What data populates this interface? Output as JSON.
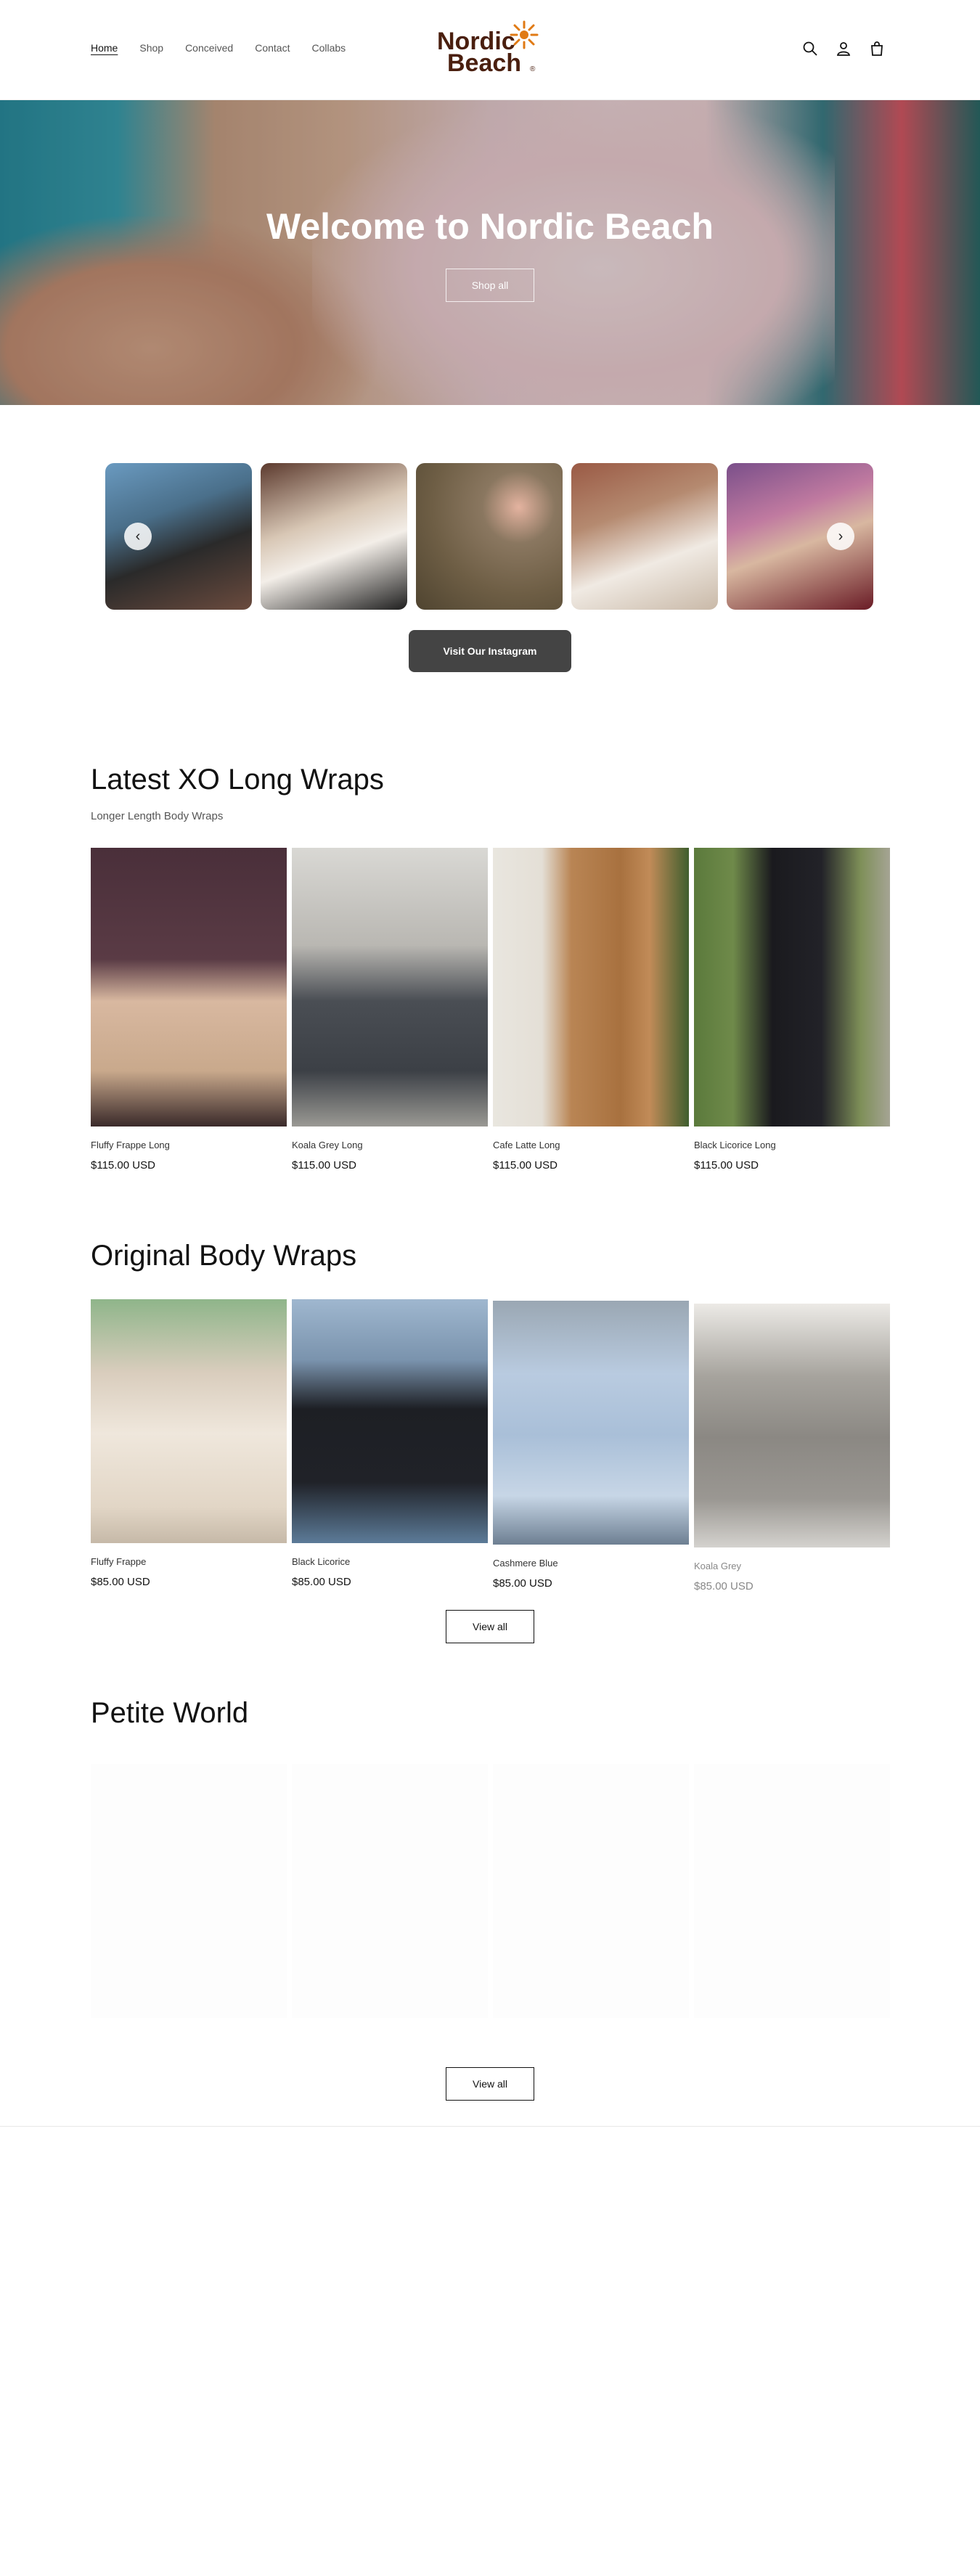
{
  "header": {
    "nav": [
      "Home",
      "Shop",
      "Conceived",
      "Contact",
      "Collabs"
    ],
    "logo_line1": "Nordic",
    "logo_line2": "Beach",
    "logo_mark": "®",
    "icons": [
      "search-icon",
      "account-icon",
      "cart-icon"
    ],
    "brand_color": "#4a1f0f",
    "sun_color": "#e07a14"
  },
  "hero": {
    "title": "Welcome to Nordic Beach",
    "button": "Shop all"
  },
  "instagram": {
    "button": "Visit Our Instagram",
    "arrow_prev": "‹",
    "arrow_next": "›"
  },
  "latest": {
    "title": "Latest XO Long Wraps",
    "subtitle": "Longer Length Body Wraps",
    "products": [
      {
        "name": "Fluffy Frappe Long",
        "price": "$115.00 USD"
      },
      {
        "name": "Koala Grey Long",
        "price": "$115.00 USD"
      },
      {
        "name": "Cafe Latte Long",
        "price": "$115.00 USD"
      },
      {
        "name": "Black Licorice Long",
        "price": "$115.00 USD"
      }
    ]
  },
  "original": {
    "title": "Original Body Wraps",
    "products": [
      {
        "name": "Fluffy Frappe",
        "price": "$85.00 USD"
      },
      {
        "name": "Black Licorice",
        "price": "$85.00 USD"
      },
      {
        "name": "Cashmere Blue",
        "price": "$85.00 USD"
      },
      {
        "name": "Koala Grey",
        "price": "$85.00 USD"
      }
    ],
    "view_all": "View all"
  },
  "petite": {
    "title": "Petite World",
    "view_all": "View all"
  }
}
